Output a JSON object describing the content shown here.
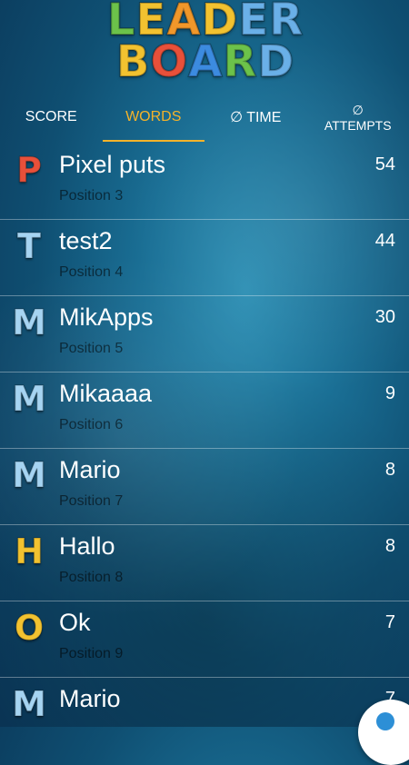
{
  "logo": {
    "line1": [
      {
        "ch": "L",
        "color": "#6cc24a"
      },
      {
        "ch": "E",
        "color": "#f2c230"
      },
      {
        "ch": "A",
        "color": "#f0972a"
      },
      {
        "ch": "D",
        "color": "#f2c230"
      },
      {
        "ch": "E",
        "color": "#6ab0e8"
      },
      {
        "ch": "R",
        "color": "#6ab0e8"
      }
    ],
    "line2": [
      {
        "ch": "B",
        "color": "#f2c230"
      },
      {
        "ch": "O",
        "color": "#e8503a"
      },
      {
        "ch": "A",
        "color": "#3c8be0"
      },
      {
        "ch": "R",
        "color": "#6cc24a"
      },
      {
        "ch": "D",
        "color": "#6ab0e8"
      }
    ]
  },
  "tabs": {
    "score": "SCORE",
    "words": "WORDS",
    "time": "∅ TIME",
    "attempts_symbol": "∅",
    "attempts": "ATTEMPTS"
  },
  "rows": [
    {
      "letter": "P",
      "letter_color": "#e8503a",
      "name": "Pixel puts",
      "position": "Position 3",
      "score": "54"
    },
    {
      "letter": "T",
      "letter_color": "#a6d4f2",
      "name": "test2",
      "position": "Position 4",
      "score": "44"
    },
    {
      "letter": "M",
      "letter_color": "#a6d4f2",
      "name": "MikApps",
      "position": "Position 5",
      "score": "30"
    },
    {
      "letter": "M",
      "letter_color": "#a6d4f2",
      "name": "Mikaaaa",
      "position": "Position 6",
      "score": "9"
    },
    {
      "letter": "M",
      "letter_color": "#a6d4f2",
      "name": "Mario",
      "position": "Position 7",
      "score": "8"
    },
    {
      "letter": "H",
      "letter_color": "#f2c230",
      "name": "Hallo",
      "position": "Position 8",
      "score": "8"
    },
    {
      "letter": "O",
      "letter_color": "#f2c230",
      "name": "Ok",
      "position": "Position 9",
      "score": "7"
    },
    {
      "letter": "M",
      "letter_color": "#a6d4f2",
      "name": "Mario",
      "position": "",
      "score": "7"
    }
  ]
}
